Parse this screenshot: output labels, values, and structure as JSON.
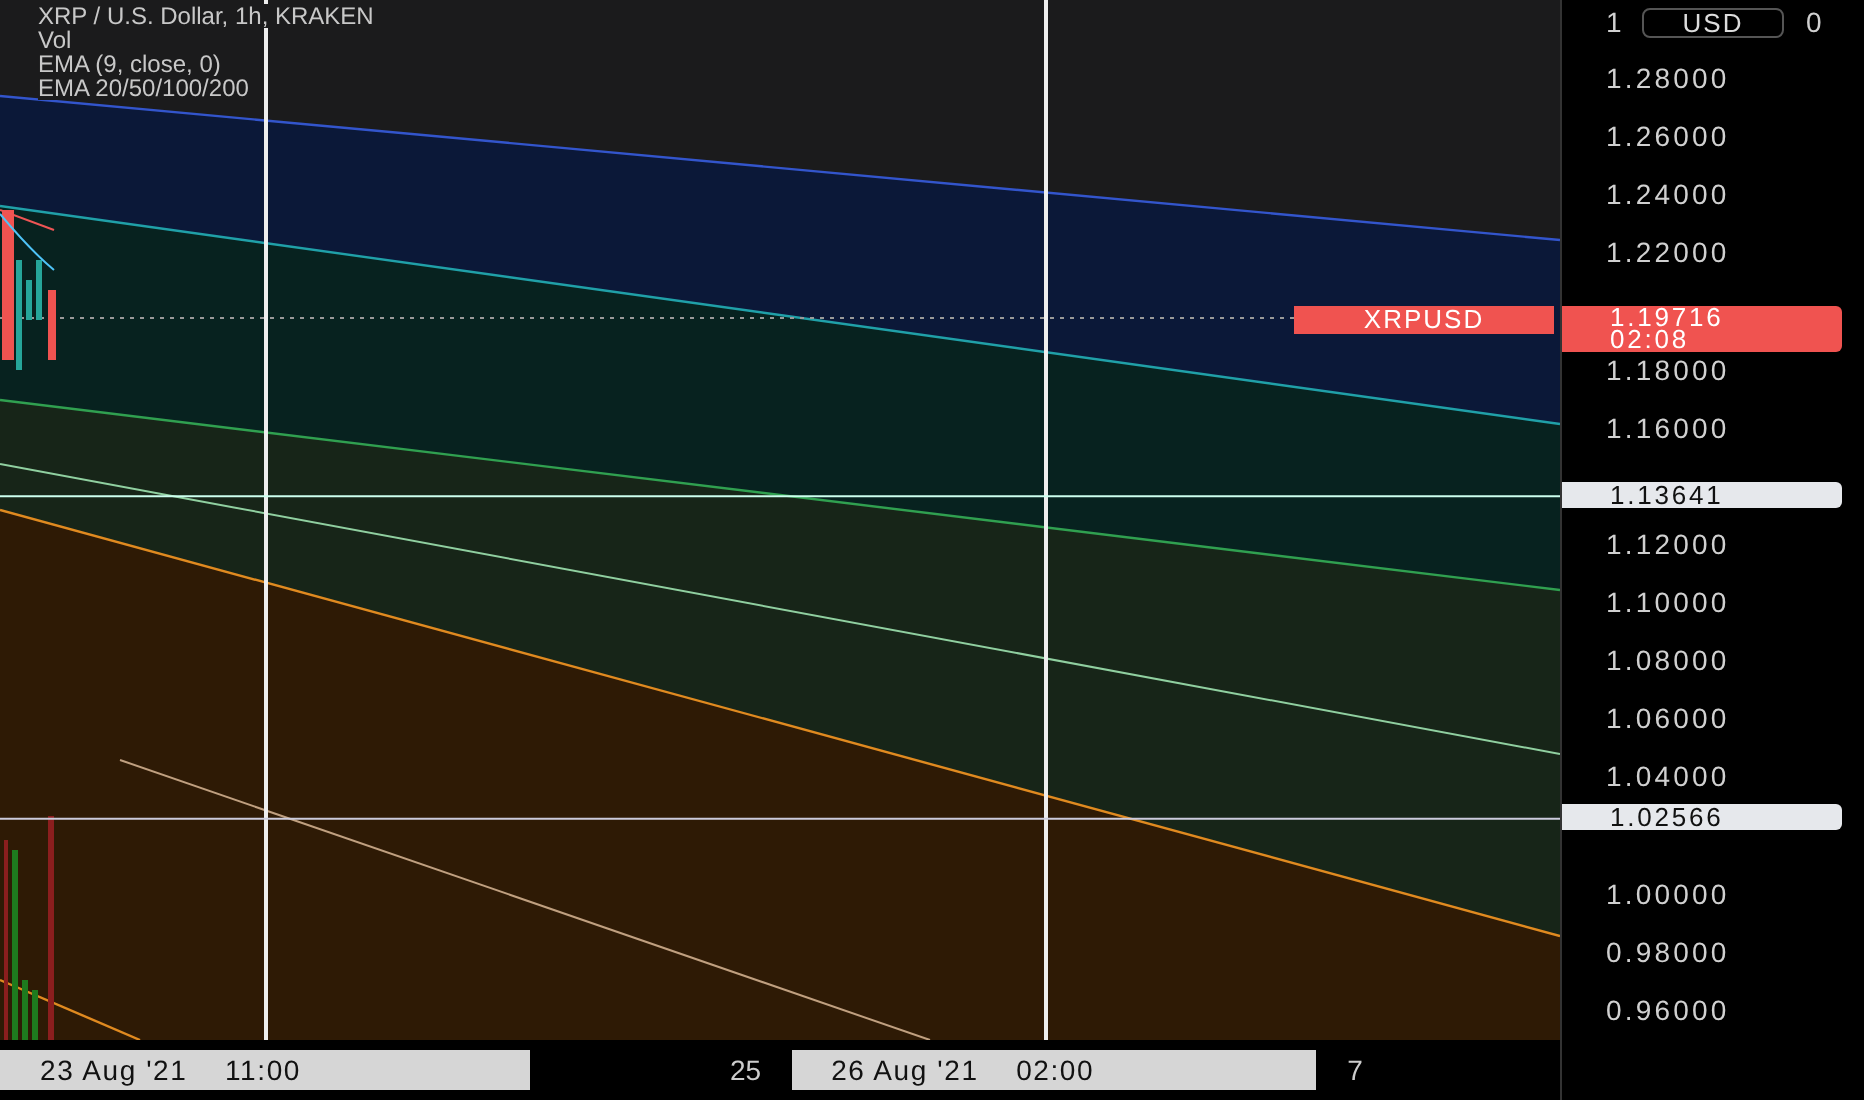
{
  "legend": [
    "XRP / U.S. Dollar, 1h, KRAKEN",
    "Vol",
    "EMA (9, close, 0)",
    "EMA 20/50/100/200"
  ],
  "price_axis": {
    "currency_button": "USD",
    "top_tick_parts": [
      "1",
      "0"
    ],
    "ticks": [
      "1.28000",
      "1.26000",
      "1.24000",
      "1.22000",
      "1.18000",
      "1.16000",
      "1.12000",
      "1.10000",
      "1.08000",
      "1.06000",
      "1.04000",
      "1.00000",
      "0.98000",
      "0.96000"
    ],
    "last_price": {
      "symbol": "XRPUSD",
      "price": "1.19716",
      "countdown": "02:08"
    },
    "markers": [
      "1.13641",
      "1.02566"
    ]
  },
  "time_axis": {
    "labels": [
      {
        "text": "23 Aug '21",
        "time": "11:00",
        "kind": "marker"
      },
      {
        "text": "25",
        "kind": "tick"
      },
      {
        "text": "26 Aug '21",
        "time": "02:00",
        "kind": "marker"
      },
      {
        "text": "7",
        "kind": "tick"
      }
    ]
  }
}
